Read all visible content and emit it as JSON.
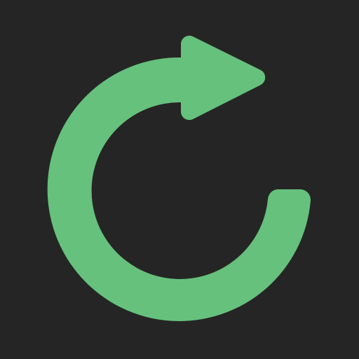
{
  "icon": {
    "name": "refresh-icon",
    "color": "#66c17c",
    "background": "#252525"
  }
}
